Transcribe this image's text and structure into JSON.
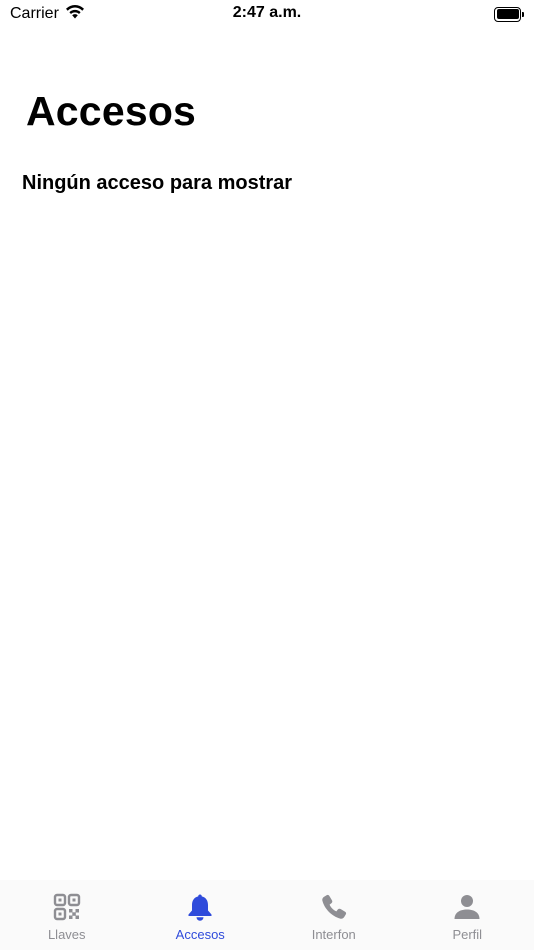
{
  "status_bar": {
    "carrier": "Carrier",
    "time": "2:47 a.m.",
    "icons": [
      "wifi-icon",
      "battery-icon"
    ]
  },
  "main": {
    "title": "Accesos",
    "empty_message": "Ningún acceso para mostrar"
  },
  "tab_bar": {
    "items": [
      {
        "label": "Llaves",
        "icon": "qr-code-icon",
        "active": false
      },
      {
        "label": "Accesos",
        "icon": "bell-icon",
        "active": true
      },
      {
        "label": "Interfon",
        "icon": "phone-icon",
        "active": false
      },
      {
        "label": "Perfil",
        "icon": "person-icon",
        "active": false
      }
    ]
  },
  "colors": {
    "accent": "#2f4bdb",
    "inactive": "#8e8e93",
    "background": "#ffffff",
    "tab_bar_background": "#fafafa"
  }
}
